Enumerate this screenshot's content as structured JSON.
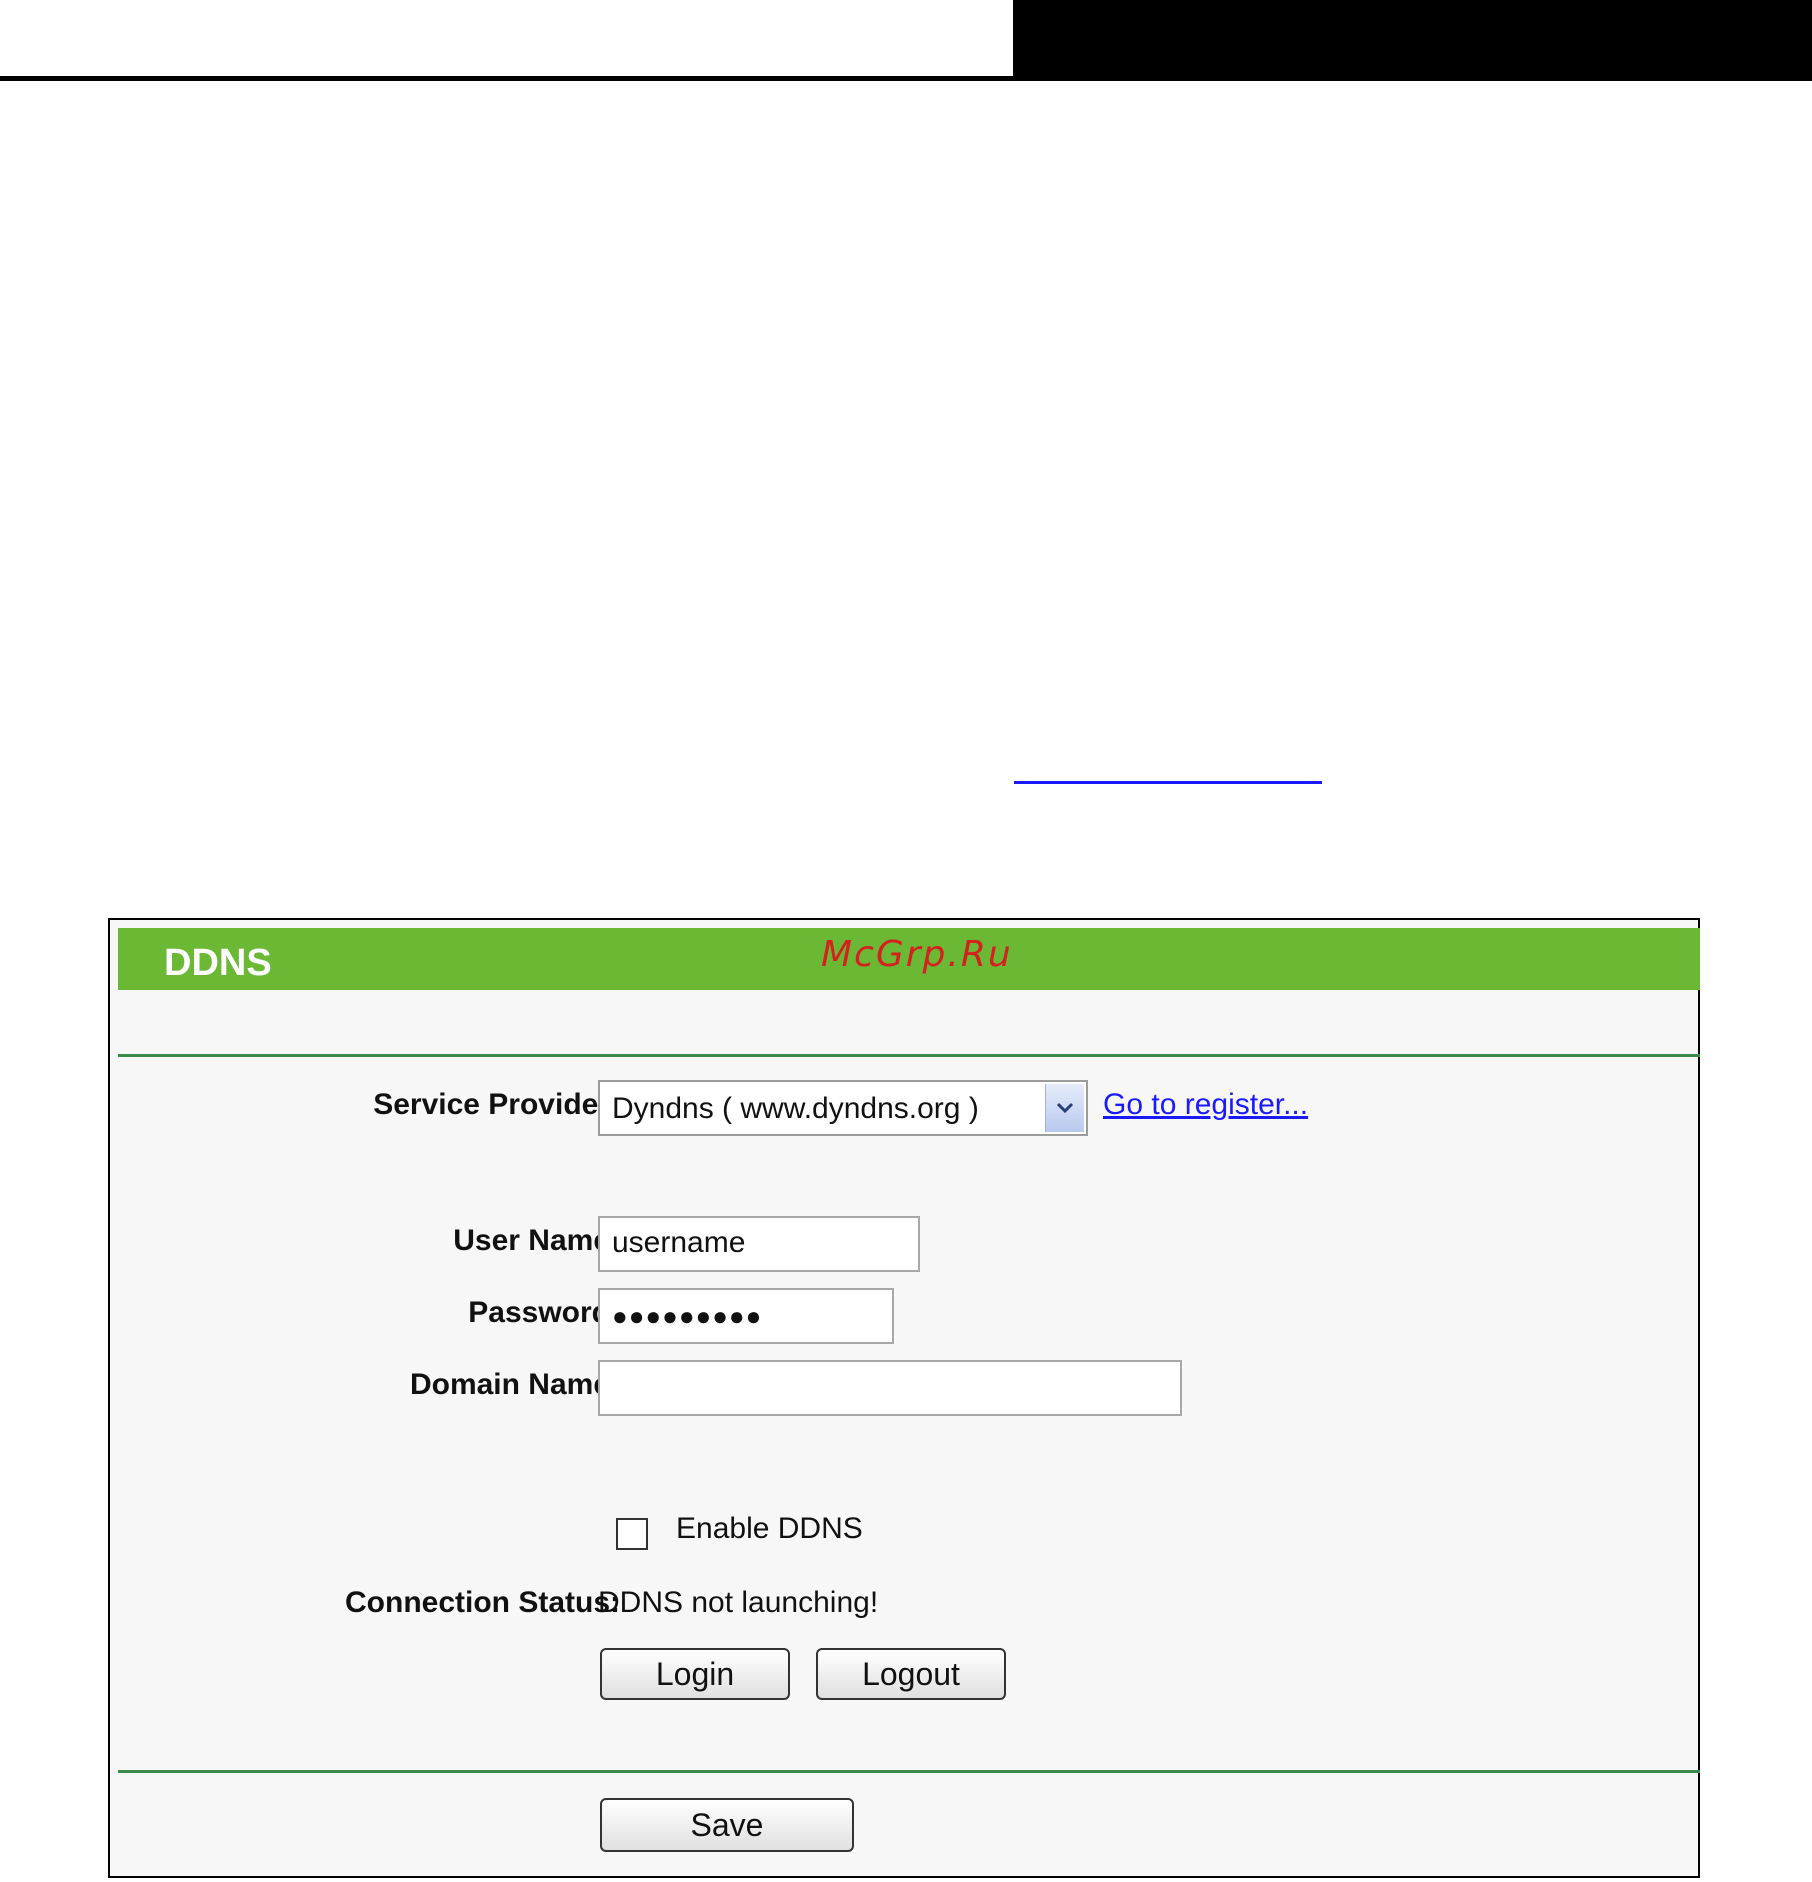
{
  "panel": {
    "title": "DDNS",
    "watermark": "McGrp.Ru"
  },
  "form": {
    "service_provider_label": "Service Provider:",
    "service_provider_value": "Dyndns ( www.dyndns.org )",
    "register_link": "Go to register...",
    "username_label": "User Name:",
    "username_value": "username",
    "password_label": "Password:",
    "password_value": "●●●●●●●●●",
    "domain_label": "Domain Name:",
    "domain_value": "",
    "enable_label": "Enable DDNS",
    "enable_checked": false,
    "status_label": "Connection Status:",
    "status_value": "DDNS not launching!"
  },
  "buttons": {
    "login": "Login",
    "logout": "Logout",
    "save": "Save"
  },
  "icons": {
    "dropdown": "chevron-down-icon"
  },
  "colors": {
    "header": "#6ab833",
    "separator": "#3a8a4a",
    "link": "#1a1aff",
    "watermark": "#d62020"
  }
}
